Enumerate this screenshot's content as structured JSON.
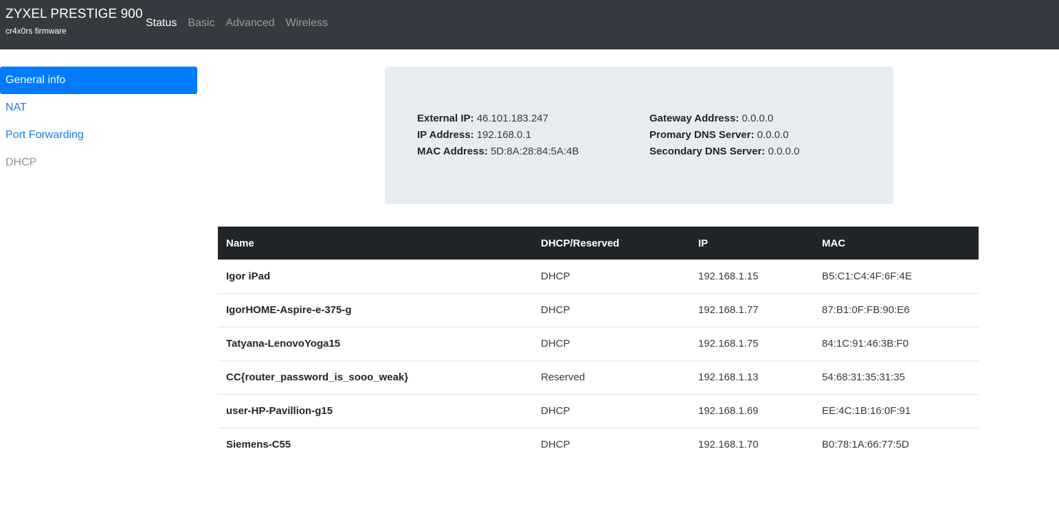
{
  "header": {
    "title": "ZYXEL PRESTIGE 900",
    "subtitle": "cr4x0rs firmware",
    "nav": [
      "Status",
      "Basic",
      "Advanced",
      "Wireless"
    ]
  },
  "sidebar": {
    "items": [
      "General info",
      "NAT",
      "Port Forwarding",
      "DHCP"
    ]
  },
  "info": {
    "external_ip_label": "External IP:",
    "external_ip": "46.101.183.247",
    "ip_address_label": "IP Address:",
    "ip_address": "192.168.0.1",
    "mac_address_label": "MAC Address:",
    "mac_address": "5D:8A:28:84:5A:4B",
    "gateway_label": "Gateway Address:",
    "gateway": "0.0.0.0",
    "primary_dns_label": "Promary DNS Server:",
    "primary_dns": "0.0.0.0",
    "secondary_dns_label": "Secondary DNS Server:",
    "secondary_dns": "0.0.0.0"
  },
  "table": {
    "headers": [
      "Name",
      "DHCP/Reserved",
      "IP",
      "MAC"
    ],
    "rows": [
      [
        "Igor iPad",
        "DHCP",
        "192.168.1.15",
        "B5:C1:C4:4F:6F:4E"
      ],
      [
        "IgorHOME-Aspire-e-375-g",
        "DHCP",
        "192.168.1.77",
        "87:B1:0F:FB:90:E6"
      ],
      [
        "Tatyana-LenovoYoga15",
        "DHCP",
        "192.168.1.75",
        "84:1C:91:46:3B:F0"
      ],
      [
        "CC{router_password_is_sooo_weak}",
        "Reserved",
        "192.168.1.13",
        "54:68:31:35:31:35"
      ],
      [
        "user-HP-Pavillion-g15",
        "DHCP",
        "192.168.1.69",
        "EE:4C:1B:16:0F:91"
      ],
      [
        "Siemens-C55",
        "DHCP",
        "192.168.1.70",
        "B0:78:1A:66:77:5D"
      ]
    ]
  }
}
